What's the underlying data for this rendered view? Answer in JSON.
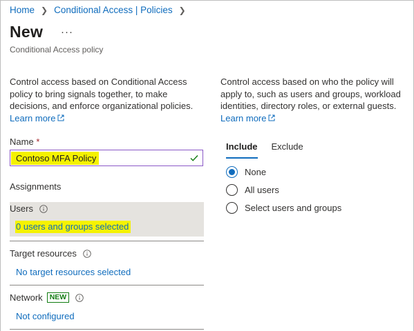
{
  "breadcrumb": {
    "home": "Home",
    "policies": "Conditional Access | Policies"
  },
  "page": {
    "title": "New",
    "subtitle": "Conditional Access policy"
  },
  "left": {
    "description": "Control access based on Conditional Access policy to bring signals together, to make decisions, and enforce organizational policies.",
    "learn_more": "Learn more",
    "name_label": "Name",
    "required_mark": "*",
    "name_value": "Contoso MFA Policy",
    "assignments_heading": "Assignments",
    "users_label": "Users",
    "users_value": "0 users and groups selected",
    "target_label": "Target resources",
    "target_value": "No target resources selected",
    "network_label": "Network",
    "network_badge": "NEW",
    "network_value": "Not configured"
  },
  "right": {
    "description": "Control access based on who the policy will apply to, such as users and groups, workload identities, directory roles, or external guests.",
    "learn_more": "Learn more",
    "tabs": [
      "Include",
      "Exclude"
    ],
    "options": [
      "None",
      "All users",
      "Select users and groups"
    ],
    "selected_option": "None"
  },
  "colors": {
    "link": "#0f6cbd",
    "highlight": "#f5f200",
    "badge": "#107c10"
  }
}
